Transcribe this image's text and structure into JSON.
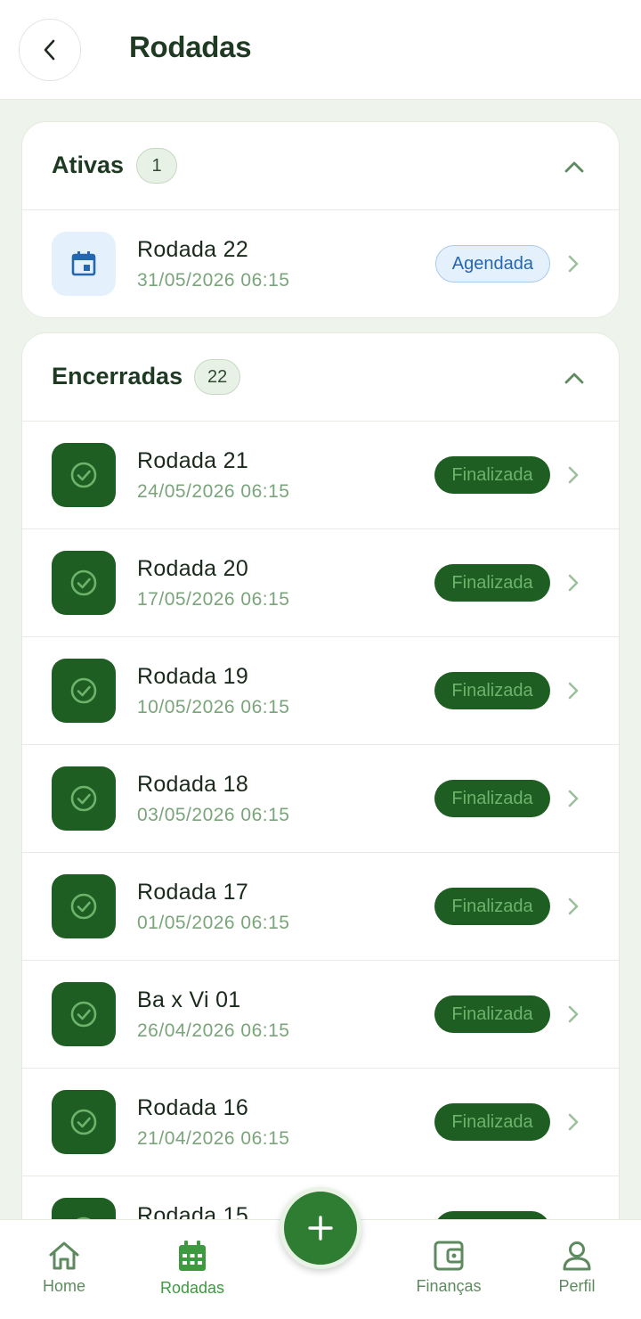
{
  "header": {
    "title": "Rodadas"
  },
  "active": {
    "title": "Ativas",
    "count": "1",
    "items": [
      {
        "name": "Rodada 22",
        "date": "31/05/2026 06:15",
        "status": "Agendada"
      }
    ]
  },
  "closed": {
    "title": "Encerradas",
    "count": "22",
    "items": [
      {
        "name": "Rodada 21",
        "date": "24/05/2026 06:15",
        "status": "Finalizada"
      },
      {
        "name": "Rodada 20",
        "date": "17/05/2026 06:15",
        "status": "Finalizada"
      },
      {
        "name": "Rodada 19",
        "date": "10/05/2026 06:15",
        "status": "Finalizada"
      },
      {
        "name": "Rodada 18",
        "date": "03/05/2026 06:15",
        "status": "Finalizada"
      },
      {
        "name": "Rodada 17",
        "date": "01/05/2026 06:15",
        "status": "Finalizada"
      },
      {
        "name": "Ba x Vi 01",
        "date": "26/04/2026 06:15",
        "status": "Finalizada"
      },
      {
        "name": "Rodada 16",
        "date": "21/04/2026 06:15",
        "status": "Finalizada"
      },
      {
        "name": "Rodada 15",
        "date": "",
        "status": ""
      }
    ]
  },
  "nav": {
    "home": "Home",
    "rounds": "Rodadas",
    "finances": "Finanças",
    "profile": "Perfil"
  },
  "colors": {
    "primary": "#2f7d32",
    "dark_green": "#1f5e22",
    "scheduled_blue": "#2467b0",
    "muted_green": "#7aa57a"
  },
  "icons": {
    "back": "chevron-left-icon",
    "collapse": "chevron-up-icon",
    "scheduled": "calendar-icon",
    "finished": "check-circle-icon",
    "open": "chevron-right-icon",
    "fab": "plus-icon"
  }
}
